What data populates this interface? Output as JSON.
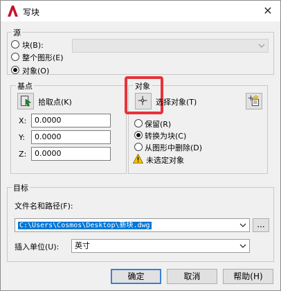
{
  "window": {
    "title": "写块",
    "close": "✕"
  },
  "source": {
    "legend": "源",
    "block_label": "块(B):",
    "whole_drawing_label": "整个图形(E)",
    "objects_label": "对象(O)",
    "selected": "objects"
  },
  "base_point": {
    "legend": "基点",
    "pick_label": "拾取点(K)",
    "x_label": "X:",
    "x_value": "0.0000",
    "y_label": "Y:",
    "y_value": "0.0000",
    "z_label": "Z:",
    "z_value": "0.0000"
  },
  "objects": {
    "legend": "对象",
    "select_label": "选择对象(T)",
    "retain_label": "保留(R)",
    "convert_label": "转换为块(C)",
    "delete_label": "从图形中删除(D)",
    "selected": "convert",
    "warning_text": "未选定对象"
  },
  "destination": {
    "legend": "目标",
    "filename_label": "文件名和路径(F):",
    "path_value": "C:\\Users\\Cosmos\\Desktop\\新块.dwg",
    "browse_label": "...",
    "units_label": "插入单位(U):",
    "units_value": "英寸"
  },
  "buttons": {
    "ok": "确定",
    "cancel": "取消",
    "help": "帮助(H)"
  },
  "colors": {
    "accent": "#0078d7",
    "highlight": "#e8323a",
    "app_icon": "#c8102e"
  },
  "icons": [
    "autocad-app-icon",
    "close-icon",
    "pick-point-icon",
    "select-objects-icon",
    "quick-select-icon",
    "warning-icon",
    "chevron-down-icon"
  ]
}
